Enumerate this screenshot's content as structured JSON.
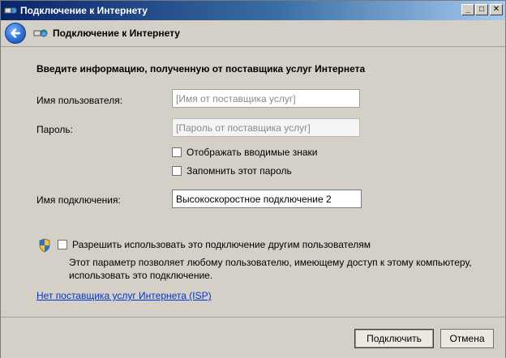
{
  "window": {
    "title": "Подключение к Интернету",
    "controls": {
      "minimize": "_",
      "maximize": "□",
      "close": "✕"
    }
  },
  "nav": {
    "back_icon": "back-arrow-icon",
    "page_icon": "network-globe-icon",
    "title": "Подключение к Интернету"
  },
  "form": {
    "heading": "Введите информацию, полученную от поставщика услуг Интернета",
    "username_label": "Имя пользователя:",
    "username_value": "",
    "username_placeholder": "[Имя от поставщика услуг]",
    "password_label": "Пароль:",
    "password_value": "",
    "password_placeholder": "[Пароль от поставщика услуг]",
    "show_chars_label": "Отображать вводимые знаки",
    "show_chars_checked": false,
    "remember_label": "Запомнить этот пароль",
    "remember_checked": false,
    "connection_name_label": "Имя подключения:",
    "connection_name_value": "Высокоскоростное подключение 2"
  },
  "sharing": {
    "icon": "uac-shield-icon",
    "label": "Разрешить использовать это подключение другим пользователям",
    "checked": false,
    "description": "Этот параметр позволяет любому пользователю, имеющему доступ к этому компьютеру, использовать это подключение."
  },
  "isp_link": "Нет поставщика услуг Интернета (ISP)",
  "buttons": {
    "connect": "Подключить",
    "cancel": "Отмена"
  }
}
